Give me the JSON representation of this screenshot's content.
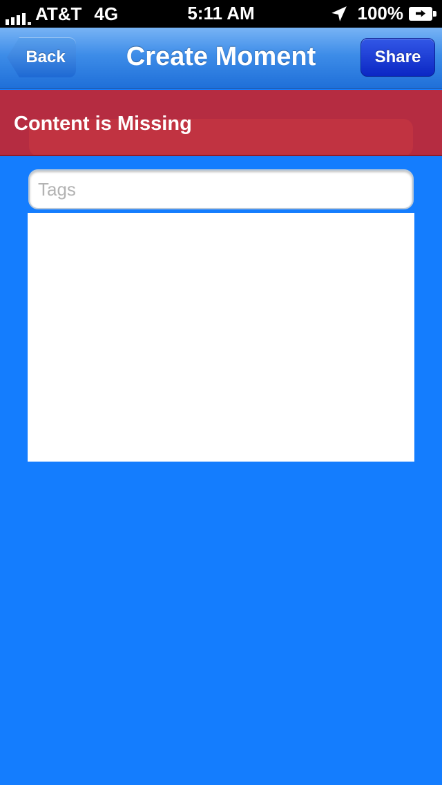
{
  "status_bar": {
    "carrier": "AT&T",
    "network": "4G",
    "time": "5:11 AM",
    "battery": "100%"
  },
  "navbar": {
    "back_label": "Back",
    "title": "Create Moment",
    "share_label": "Share"
  },
  "alert": {
    "message": "Content is Missing"
  },
  "form": {
    "tags_placeholder": "Tags",
    "tags_value": ""
  },
  "colors": {
    "background": "#147dfe",
    "alert": "#be2837",
    "share_button": "#0b27c4"
  },
  "icons": [
    "signal-icon",
    "location-arrow-icon",
    "battery-icon",
    "back-chevron-icon"
  ]
}
